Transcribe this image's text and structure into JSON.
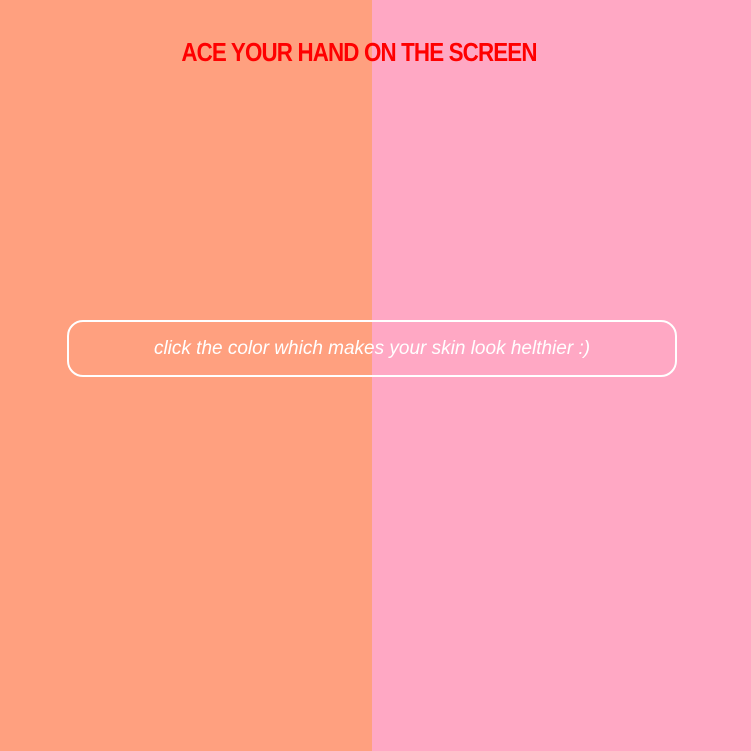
{
  "title": "ACE YOUR HAND ON THE SCREEN",
  "instruction": "click the color which makes your skin look helthier :)",
  "colors": {
    "left_panel": "#FFA07F",
    "right_panel": "#FFA8C4",
    "title": "#FF0000",
    "box_border": "#FFFFFF",
    "text": "#FFFFFF"
  }
}
